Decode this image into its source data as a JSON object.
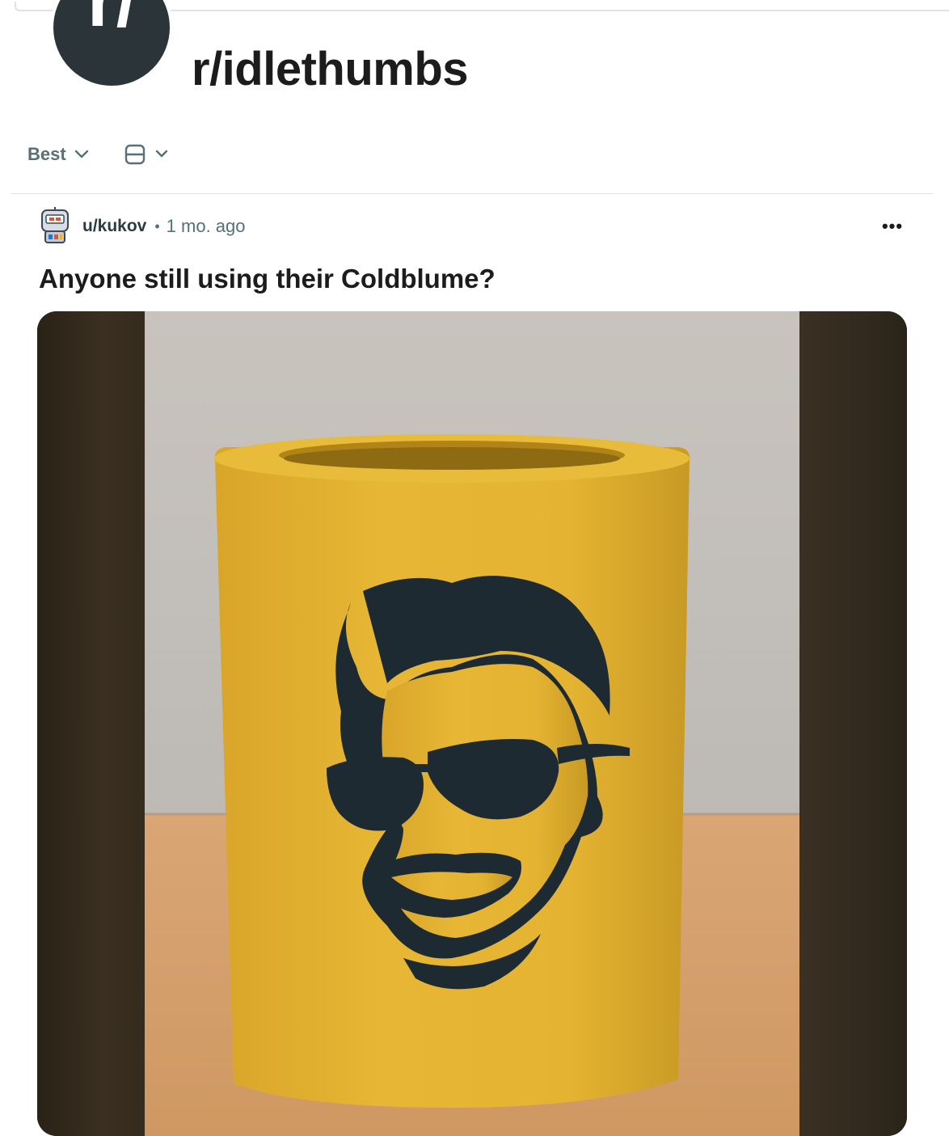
{
  "subreddit": {
    "name": "r/idlethumbs",
    "icon": "reddit-r-slash-icon",
    "avatar_text": "r/"
  },
  "sort": {
    "label": "Best",
    "icon": "chevron-down-icon"
  },
  "view": {
    "icon": "card-view-icon",
    "chevron": "chevron-down-icon"
  },
  "post": {
    "author": "u/kukov",
    "separator": "•",
    "time": "1 mo. ago",
    "more": "•••",
    "title": "Anyone still using their Coldblume?",
    "image_description_icon": "koozie-photo"
  },
  "colors": {
    "subreddit_avatar_bg": "#2b3439",
    "meta_text": "#576f76",
    "koozie_yellow": "#e4b431",
    "wall": "#c7c2bd",
    "table": "#d59f68"
  }
}
